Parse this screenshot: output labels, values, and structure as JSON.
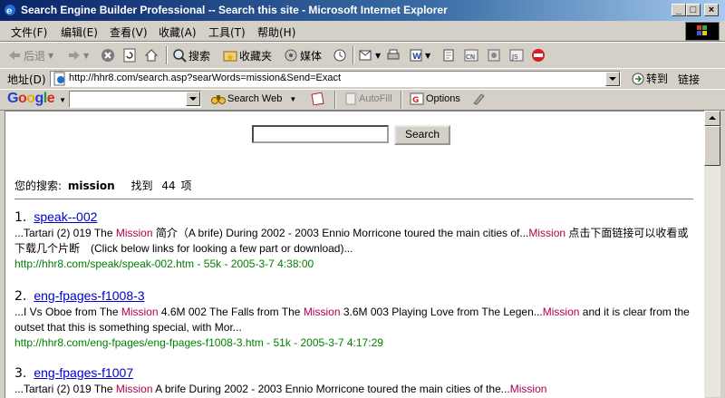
{
  "window": {
    "title": "Search Engine Builder Professional -- Search this site - Microsoft Internet Explorer",
    "min_glyph": "_",
    "max_glyph": "□",
    "close_glyph": "×"
  },
  "menu": [
    "文件(F)",
    "编辑(E)",
    "查看(V)",
    "收藏(A)",
    "工具(T)",
    "帮助(H)"
  ],
  "toolbar": {
    "back": "后退",
    "search": "搜索",
    "favorites": "收藏夹",
    "media": "媒体"
  },
  "address": {
    "label": "地址(D)",
    "url": "http://hhr8.com/search.asp?searWords=mission&Send=Exact",
    "go": "转到",
    "links": "链接"
  },
  "google": {
    "logo_letters": [
      "G",
      "o",
      "o",
      "g",
      "l",
      "e"
    ],
    "logo_colors": [
      "#1a3fd6",
      "#d42f1f",
      "#e8a60c",
      "#1a3fd6",
      "#1f9a3b",
      "#d42f1f"
    ],
    "search_web": "Search Web",
    "autofill": "AutoFill",
    "options": "Options"
  },
  "page": {
    "search_button": "Search",
    "summary_prefix": "您的搜索:",
    "query": "mission",
    "found_label": "找到",
    "count": "44",
    "count_unit": "项"
  },
  "results": [
    {
      "num": "1.",
      "title": "speak--002",
      "snippet": [
        {
          "t": "...Tartari (2) 019 The "
        },
        {
          "t": "Mission",
          "hl": true
        },
        {
          "t": " 简介（A brife) During 2002 - 2003 Ennio Morricone toured the main cities of..."
        },
        {
          "t": "Mission",
          "hl": true
        },
        {
          "t": " 点击下面链接可以收看或下载几个片断　(Click below links for looking a few part or download)..."
        }
      ],
      "url": "http://hhr8.com/speak/speak-002.htm - 55k - 2005-3-7 4:38:00"
    },
    {
      "num": "2.",
      "title": "eng-fpages-f1008-3",
      "snippet": [
        {
          "t": "...I Vs Oboe from The "
        },
        {
          "t": "Mission",
          "hl": true
        },
        {
          "t": " 4.6M 002 The Falls from The "
        },
        {
          "t": "Mission",
          "hl": true
        },
        {
          "t": " 3.6M 003 Playing Love from The Legen..."
        },
        {
          "t": "Mission",
          "hl": true
        },
        {
          "t": " and it is clear from the outset that this is something special, with Mor..."
        }
      ],
      "url": "http://hhr8.com/eng-fpages/eng-fpages-f1008-3.htm - 51k - 2005-3-7 4:17:29"
    },
    {
      "num": "3.",
      "title": "eng-fpages-f1007",
      "snippet": [
        {
          "t": "...Tartari (2) 019 The "
        },
        {
          "t": "Mission",
          "hl": true
        },
        {
          "t": " A brife During 2002 - 2003 Ennio Morricone toured the main cities of the..."
        },
        {
          "t": "Mission",
          "hl": true
        }
      ],
      "url": ""
    }
  ]
}
